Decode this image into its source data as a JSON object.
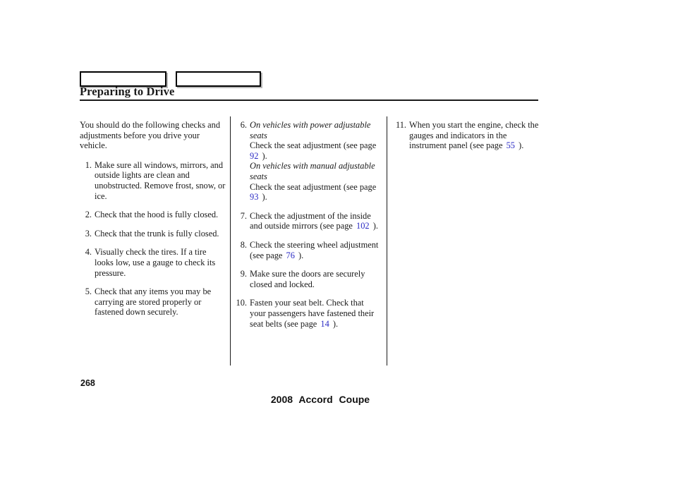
{
  "header": {
    "tab_box_1_label": "",
    "tab_box_2_label": "",
    "title": "Preparing to Drive"
  },
  "footer": {
    "page_number": "268",
    "title": "2008  Accord  Coupe"
  },
  "link_color": "#2b2bc4",
  "columns": {
    "column_1": {
      "intro": "You should do the following checks and adjustments before you drive your vehicle.",
      "items": [
        {
          "num": "1.",
          "text": "Make sure all windows, mirrors, and outside lights are clean and unobstructed. Remove frost, snow, or ice."
        },
        {
          "num": "2.",
          "text": "Check that the hood is fully closed."
        },
        {
          "num": "3.",
          "text": "Check that the trunk is fully closed."
        },
        {
          "num": "4.",
          "text": "Visually check the tires. If a tire looks low, use a gauge to check its pressure."
        },
        {
          "num": "5.",
          "text": "Check that any items you may be carrying are stored properly or fastened down securely."
        }
      ]
    },
    "column_2": {
      "item_6": {
        "num": "6.",
        "sub_head_a": "On vehicles with power adjustable seats",
        "text_a_before": "Check the seat adjustment (see page",
        "page_ref_a": "92",
        "text_a_after": ").",
        "sub_head_b": "On vehicles with manual adjustable seats",
        "text_b_before": "Check the seat adjustment (see page",
        "page_ref_b": "93",
        "text_b_after": ")."
      },
      "item_7": {
        "num": "7.",
        "text_before": "Check the adjustment of the inside and outside mirrors (see page",
        "page_ref": "102",
        "text_after": ")."
      },
      "item_8": {
        "num": "8.",
        "text_before": "Check the steering wheel adjustment (see page",
        "page_ref": "76",
        "text_after": ")."
      },
      "item_9": {
        "num": "9.",
        "text": "Make sure the doors are securely closed and locked."
      },
      "item_10": {
        "num": "10.",
        "text_before": "Fasten your seat belt. Check that your passengers have fastened their seat belts (see page",
        "page_ref": "14",
        "text_after": ")."
      }
    },
    "column_3": {
      "item_11": {
        "num": "11.",
        "text_before": "When you start the engine, check the gauges and indicators in the instrument panel (see page",
        "page_ref": "55",
        "text_after": ")."
      }
    }
  }
}
